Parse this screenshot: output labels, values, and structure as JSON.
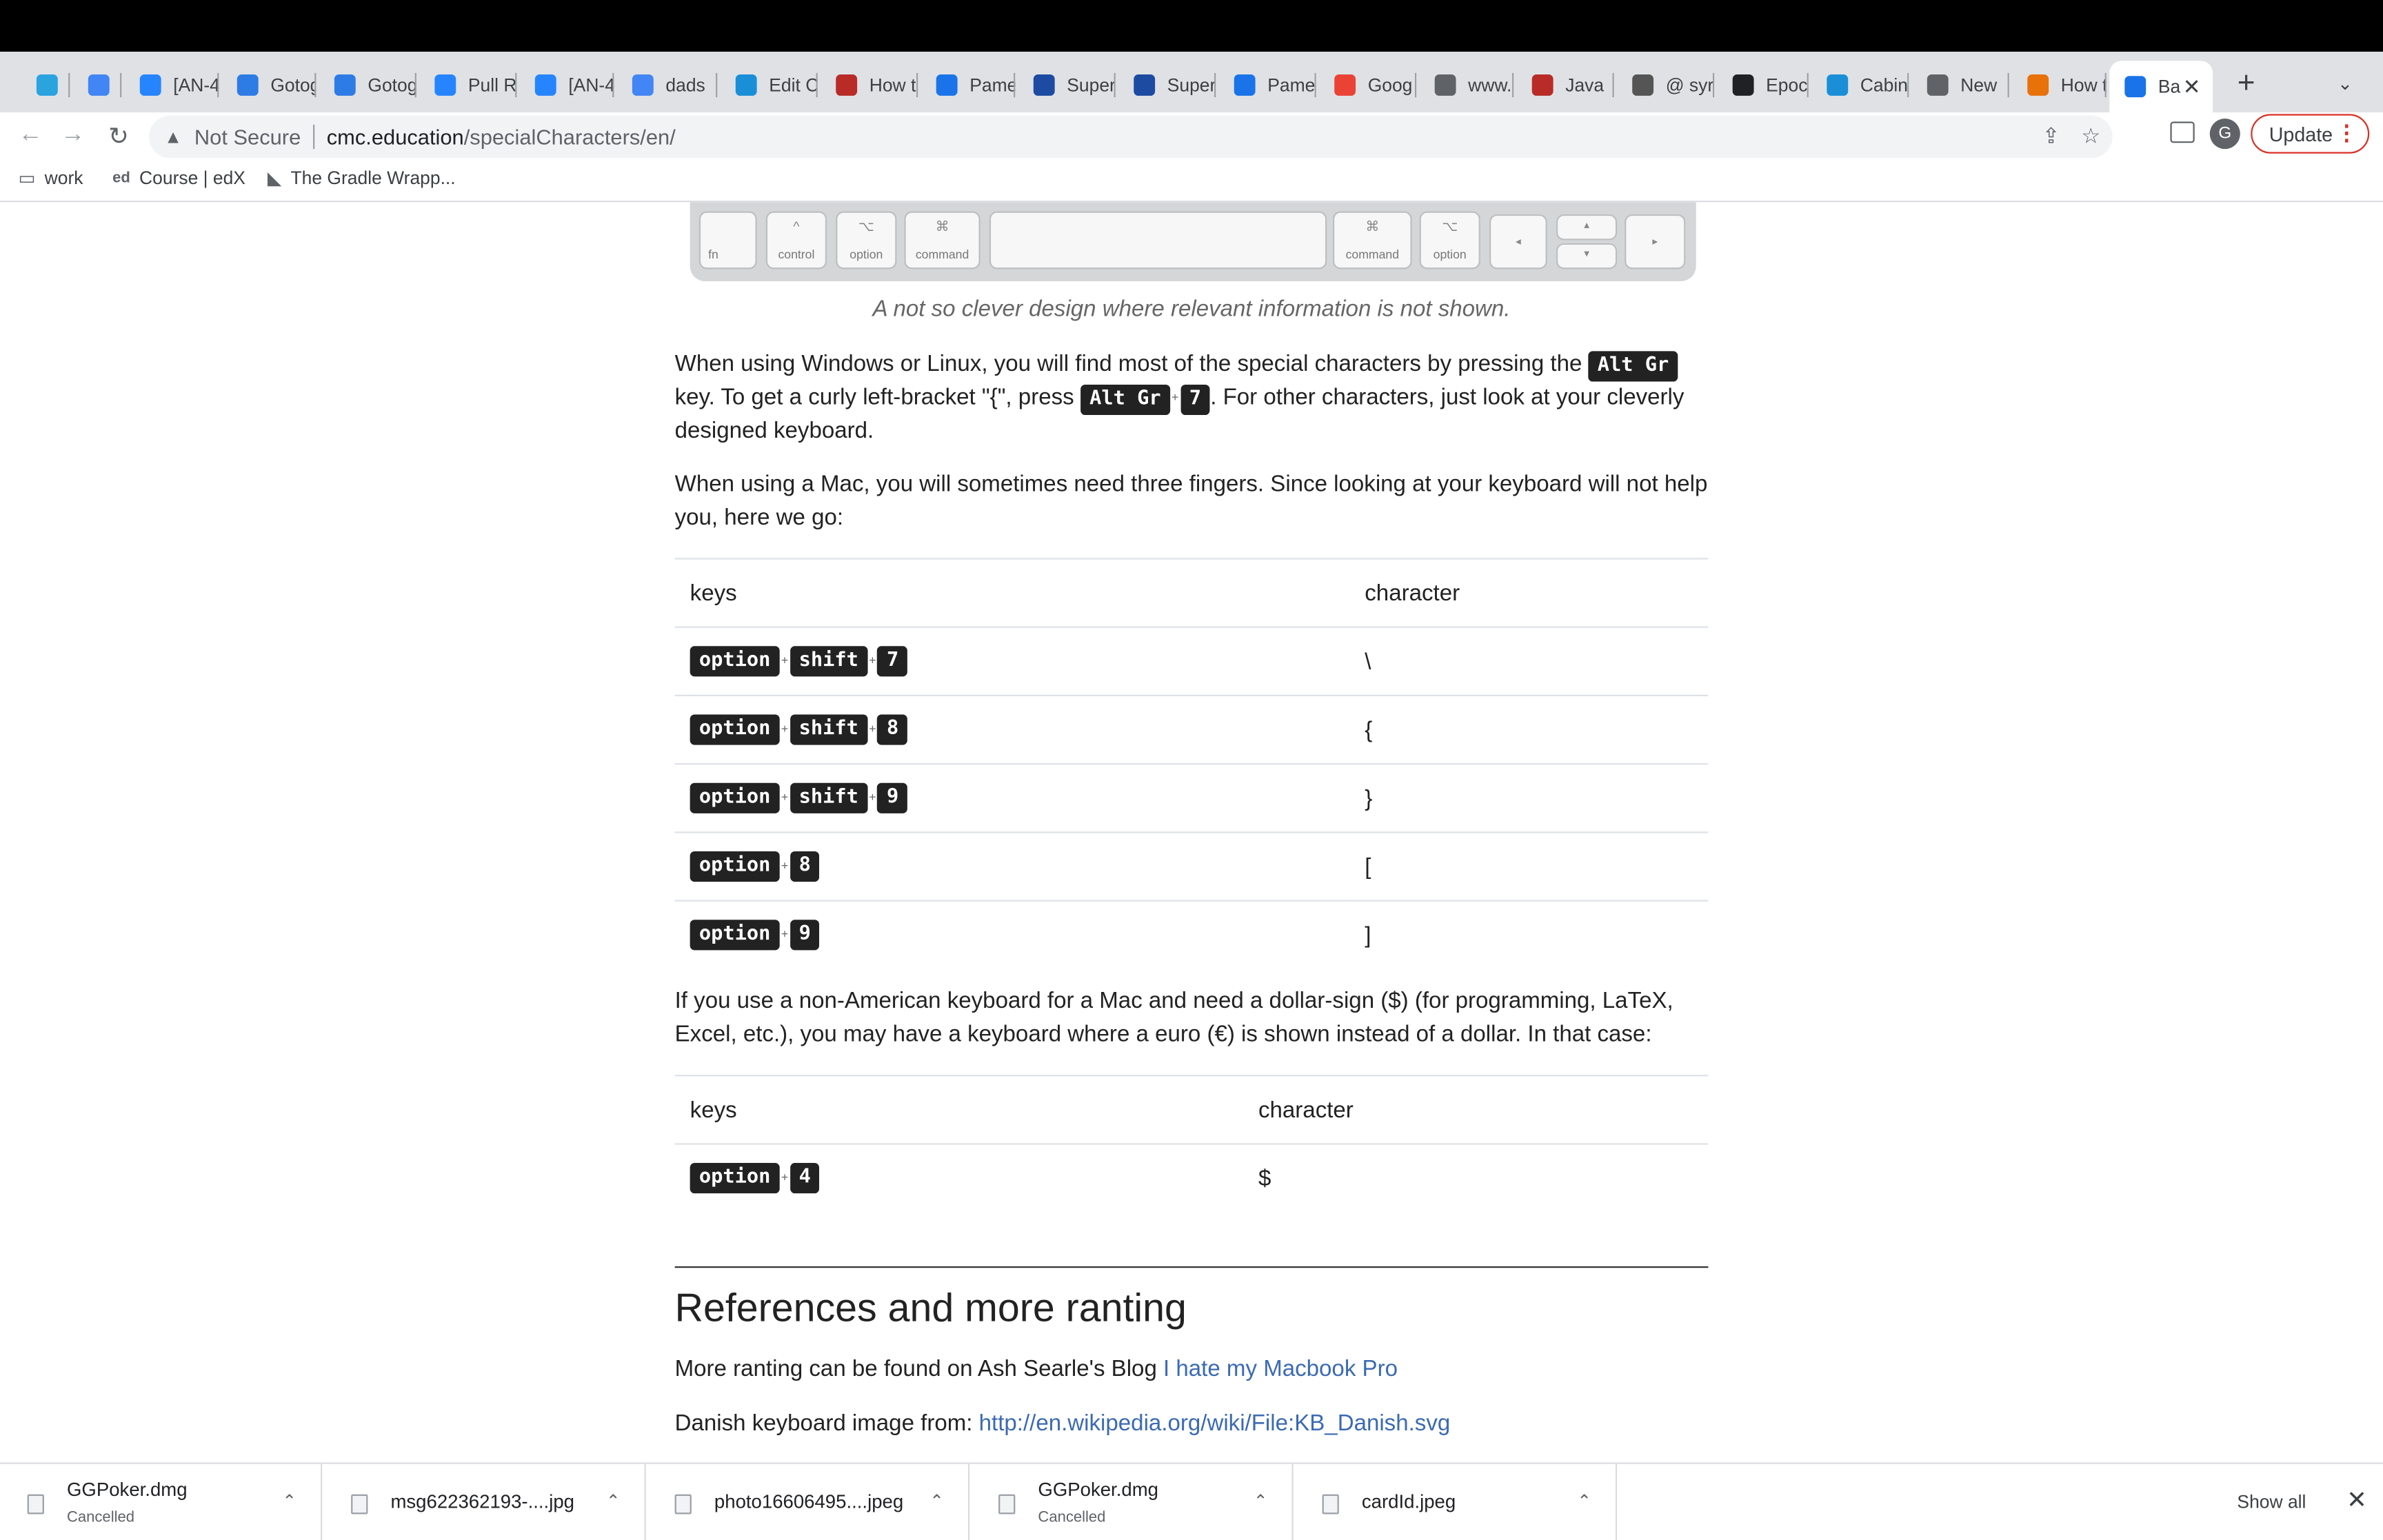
{
  "browser": {
    "tabs": [
      {
        "label": "",
        "icon": "telegram-icon",
        "color": "#2aa3df"
      },
      {
        "label": "",
        "icon": "google-icon",
        "color": "#4285f4"
      },
      {
        "label": "[AN-4",
        "icon": "jira-icon",
        "color": "#2684ff"
      },
      {
        "label": "Gotog",
        "icon": "gotogate-icon",
        "color": "#2d7be5"
      },
      {
        "label": "Gotog",
        "icon": "gotogate-icon",
        "color": "#2d7be5"
      },
      {
        "label": "Pull R",
        "icon": "bitbucket-icon",
        "color": "#2684ff"
      },
      {
        "label": "[AN-4",
        "icon": "jira-icon",
        "color": "#2684ff"
      },
      {
        "label": "dads",
        "icon": "google-icon",
        "color": "#4285f4"
      },
      {
        "label": "Edit C",
        "icon": "edge-icon",
        "color": "#1a8fd8"
      },
      {
        "label": "How t",
        "icon": "quora-icon",
        "color": "#b92b27"
      },
      {
        "label": "Pame",
        "icon": "calendar-icon",
        "color": "#1a73e8"
      },
      {
        "label": "Super",
        "icon": "app-icon",
        "color": "#1d4ba1"
      },
      {
        "label": "Super",
        "icon": "app-icon",
        "color": "#1d4ba1"
      },
      {
        "label": "Pame",
        "icon": "calendar-icon",
        "color": "#1a73e8"
      },
      {
        "label": "Goog",
        "icon": "photos-icon",
        "color": "#ea4335"
      },
      {
        "label": "www.",
        "icon": "globe-icon",
        "color": "#5f6368"
      },
      {
        "label": "Java",
        "icon": "quora-icon",
        "color": "#b92b27"
      },
      {
        "label": "@ syr",
        "icon": "apple-icon",
        "color": "#555555"
      },
      {
        "label": "Epoch",
        "icon": "clock-icon",
        "color": "#202124"
      },
      {
        "label": "Cabin",
        "icon": "edge-icon",
        "color": "#1a8fd8"
      },
      {
        "label": "New",
        "icon": "chrome-icon",
        "color": "#5f6368"
      },
      {
        "label": "How t",
        "icon": "quill-icon",
        "color": "#e8710a"
      },
      {
        "label": "Ba",
        "icon": "site-icon",
        "color": "#1a73e8",
        "active": true
      }
    ],
    "address": {
      "security_label": "Not Secure",
      "host": "cmc.education",
      "path": "/specialCharacters/en/"
    },
    "update_label": "Update",
    "avatar_initial": "G",
    "bookmarks": [
      {
        "label": "work",
        "icon": "folder-icon"
      },
      {
        "label": "Course | edX",
        "icon": "edx-icon"
      },
      {
        "label": "The Gradle Wrapp...",
        "icon": "gradle-icon"
      }
    ]
  },
  "keyboard_keys": {
    "fn": "fn",
    "control": "control",
    "option": "option",
    "command": "command",
    "control_sym": "^",
    "option_sym": "⌥",
    "command_sym": "⌘"
  },
  "article": {
    "caption": "A not so clever design where relevant information is not shown.",
    "p1_a": "When using Windows or Linux, you will find most of the special characters by pressing the ",
    "p1_kbd1": "Alt Gr",
    "p1_b": " key. To get a curly left-bracket \"{\", press ",
    "p1_kbd2": "Alt Gr",
    "p1_kbd3": "7",
    "p1_c": ". For other characters, just look at your cleverly designed keyboard.",
    "p2": "When using a Mac, you will sometimes need three fingers. Since looking at your keyboard will not help you, here we go:",
    "table1": {
      "headers": [
        "keys",
        "character"
      ],
      "rows": [
        {
          "keys": [
            "option",
            "shift",
            "7"
          ],
          "char": "\\"
        },
        {
          "keys": [
            "option",
            "shift",
            "8"
          ],
          "char": "{"
        },
        {
          "keys": [
            "option",
            "shift",
            "9"
          ],
          "char": "}"
        },
        {
          "keys": [
            "option",
            "8"
          ],
          "char": "["
        },
        {
          "keys": [
            "option",
            "9"
          ],
          "char": "]"
        }
      ]
    },
    "p3": "If you use a non-American keyboard for a Mac and need a dollar-sign ($) (for programming, LaTeX, Excel, etc.), you may have a keyboard where a euro (€) is shown instead of a dollar. In that case:",
    "table2": {
      "headers": [
        "keys",
        "character"
      ],
      "rows": [
        {
          "keys": [
            "option",
            "4"
          ],
          "char": "$"
        }
      ]
    },
    "ref_title": "References and more ranting",
    "ref_p1_text": "More ranting can be found on Ash Searle's Blog ",
    "ref_p1_link": "I hate my Macbook Pro",
    "ref_p2_text": "Danish keyboard image from: ",
    "ref_p2_link": "http://en.wikipedia.org/wiki/File:KB_Danish.svg"
  },
  "downloads": {
    "items": [
      {
        "name": "GGPoker.dmg",
        "status": "Cancelled"
      },
      {
        "name": "msg622362193-....jpg",
        "status": ""
      },
      {
        "name": "photo16606495....jpeg",
        "status": ""
      },
      {
        "name": "GGPoker.dmg",
        "status": "Cancelled"
      },
      {
        "name": "cardId.jpeg",
        "status": ""
      }
    ],
    "show_all_label": "Show all"
  }
}
